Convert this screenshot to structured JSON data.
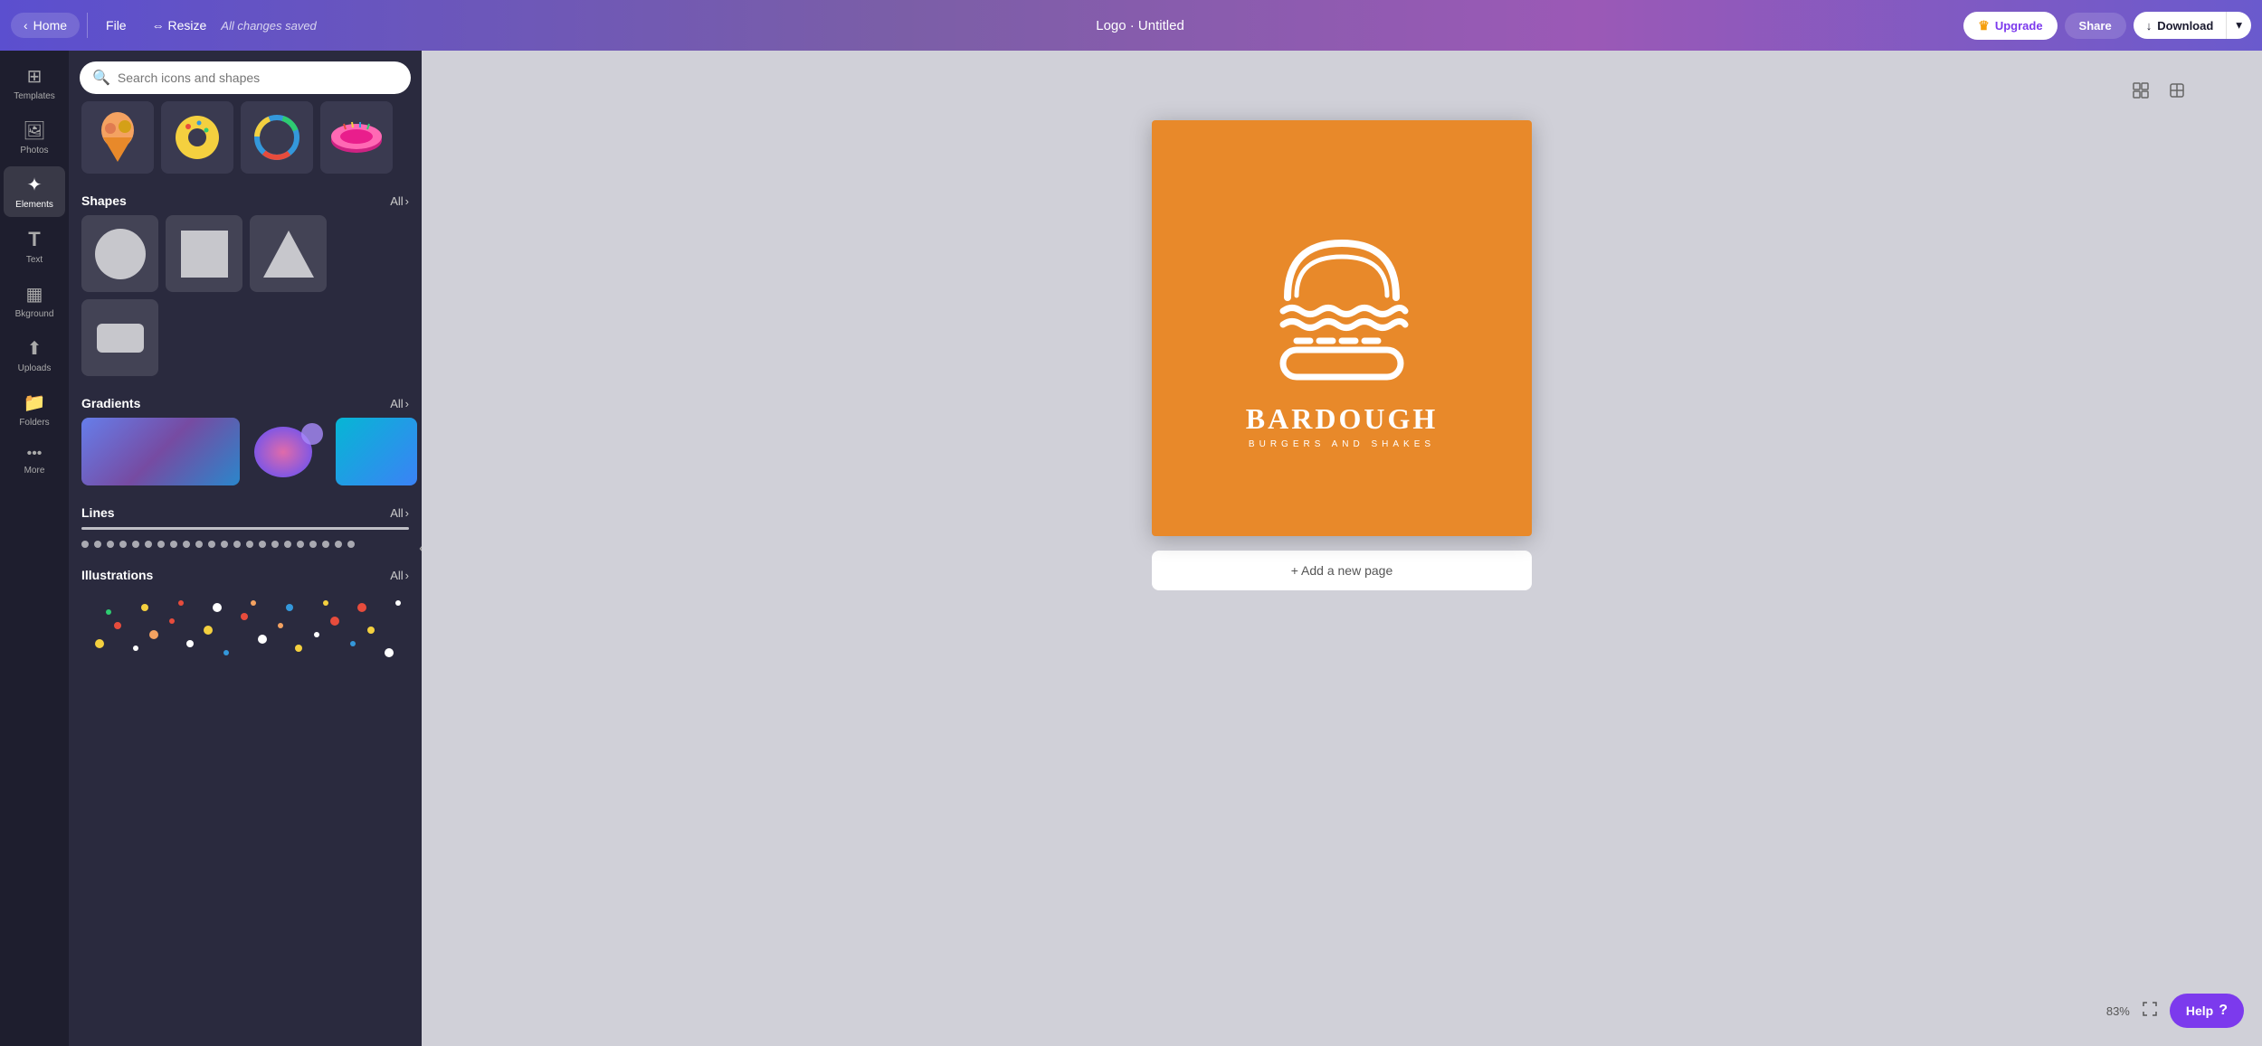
{
  "topbar": {
    "home_label": "Home",
    "file_label": "File",
    "resize_label": "Resize",
    "autosave_text": "All changes saved",
    "doc_title": "Logo · Untitled",
    "upgrade_label": "Upgrade",
    "share_label": "Share",
    "download_label": "Download"
  },
  "sidebar": {
    "items": [
      {
        "id": "templates",
        "label": "Templates",
        "icon": "⊞"
      },
      {
        "id": "photos",
        "label": "Photos",
        "icon": "🖼"
      },
      {
        "id": "elements",
        "label": "Elements",
        "icon": "✦"
      },
      {
        "id": "text",
        "label": "Text",
        "icon": "T"
      },
      {
        "id": "bkground",
        "label": "Bkground",
        "icon": "▦"
      },
      {
        "id": "uploads",
        "label": "Uploads",
        "icon": "↑"
      },
      {
        "id": "folders",
        "label": "Folders",
        "icon": "📁"
      },
      {
        "id": "more",
        "label": "More",
        "icon": "•••"
      }
    ]
  },
  "elements_panel": {
    "search_placeholder": "Search icons and shapes",
    "sections": {
      "shapes": {
        "label": "Shapes",
        "all_link": "All"
      },
      "gradients": {
        "label": "Gradients",
        "all_link": "All"
      },
      "lines": {
        "label": "Lines",
        "all_link": "All"
      },
      "illustrations": {
        "label": "Illustrations",
        "all_link": "All"
      }
    }
  },
  "canvas": {
    "brand_name": "BARDOUGH",
    "brand_sub": "BURGERS AND SHAKES",
    "add_page_label": "+ Add a new page",
    "zoom_level": "83%"
  },
  "help": {
    "label": "Help",
    "question_mark": "?"
  }
}
